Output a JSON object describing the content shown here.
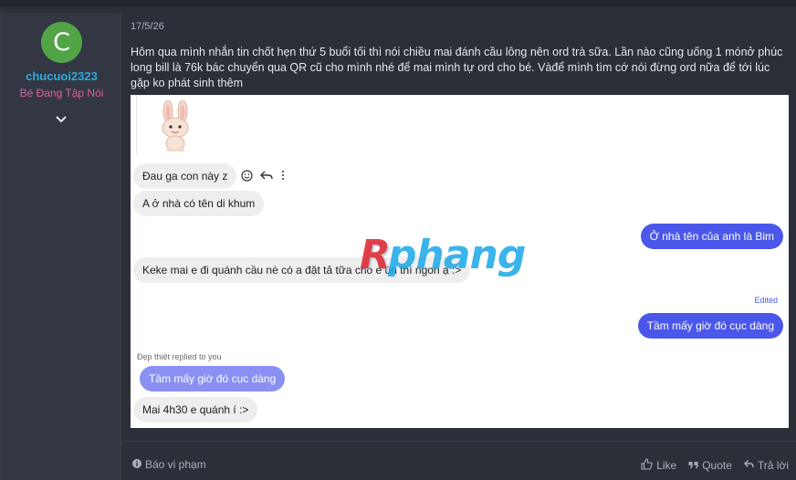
{
  "user": {
    "avatar_letter": "C",
    "avatar_color": "#52a447",
    "username": "chucuoi2323",
    "username_color": "#2eaadc",
    "title": "Bé Đang Tập Nói",
    "title_color": "#e85d9c"
  },
  "post": {
    "date": "17/5/26",
    "text": "Hôm qua mình nhắn tin chốt hẹn thứ 5 buổi tối thì nói chiều mai đánh cầu lông nên ord trà sữa. Lần nào cũng uống 1 mónở phúc long bill là 76k bác chuyển qua QR cũ cho mình nhé để mai mình tự ord cho bé. Vàđể mình tìm cớ nói đừng ord nữa để tới lúc gặp ko phát sinh thêm"
  },
  "chat": {
    "messages": [
      {
        "side": "in",
        "text": "Đau ga con này z"
      },
      {
        "side": "in",
        "text": "A ở nhà có tên di khum"
      },
      {
        "side": "out",
        "text": "Ở nhà tên của anh là Bim"
      },
      {
        "side": "in",
        "text": "Keke mai e đi quánh cầu nè có a đặt tả tữa cho e ún thì ngon ạ :>"
      },
      {
        "side": "out",
        "text": "Tầm mấy giờ đó cục dàng",
        "edited_label": "Edited"
      },
      {
        "side": "reply",
        "text": "Tầm mấy giờ đó cục dàng",
        "replied_label": "Đẹp thiệt replied to you"
      },
      {
        "side": "in",
        "text": "Mai 4h30 e quánh í :>"
      }
    ],
    "action_icons": [
      "smiley-icon",
      "reply-arrow-icon",
      "more-dots-icon"
    ],
    "sticker": "bunny-sticker",
    "colors": {
      "out_bubble": "#4b57ea",
      "in_bubble": "#eeeeee",
      "reply_bubble": "#8a90f2"
    }
  },
  "watermark": {
    "text_first": "R",
    "text_rest": "phang"
  },
  "footer": {
    "report_label": "Báo vi phạm",
    "like_label": "Like",
    "quote_label": "Quote",
    "reply_label": "Trả lời"
  }
}
